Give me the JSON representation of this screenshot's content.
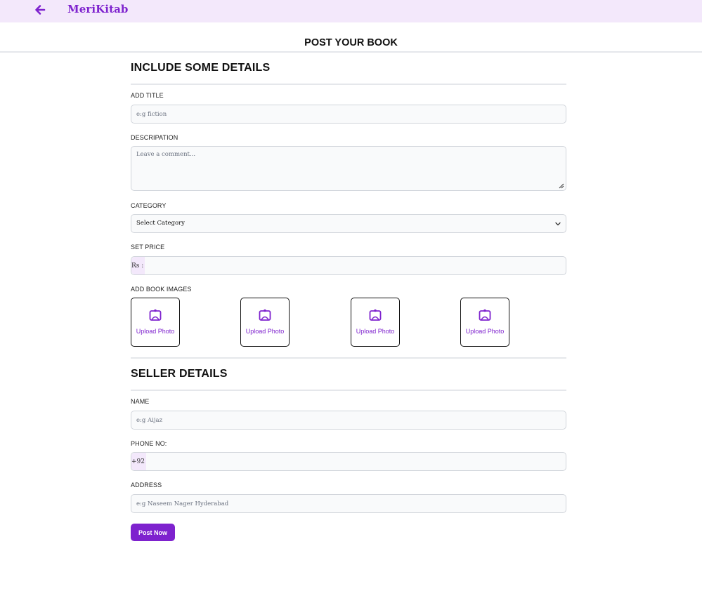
{
  "app": {
    "brand": "MeriKitab"
  },
  "page": {
    "title": "POST YOUR BOOK"
  },
  "details_section": {
    "heading": "INCLUDE SOME DETAILS",
    "title_label": "ADD TITLE",
    "title_placeholder": "e:g fiction",
    "description_label": "DESCRIPATION",
    "description_placeholder": "Leave a comment...",
    "category_label": "CATEGORY",
    "category_selected": "Select Category",
    "price_label": "SET PRICE",
    "price_prefix": "Rs :",
    "images_label": "ADD BOOK IMAGES",
    "upload_tiles": [
      {
        "label": "Upload Photo"
      },
      {
        "label": "Upload Photo"
      },
      {
        "label": "Upload Photo"
      },
      {
        "label": "Upload Photo"
      }
    ]
  },
  "seller_section": {
    "heading": "SELLER DETAILS",
    "name_label": "NAME",
    "name_placeholder": "e:g Aijaz",
    "phone_label": "PHONE NO:",
    "phone_prefix": "+92",
    "address_label": "ADDRESS",
    "address_placeholder": "e:g Naseem Nager Hyderabad"
  },
  "actions": {
    "submit_label": "Post Now"
  },
  "colors": {
    "accent": "#7e22ce",
    "topbar": "#f3e8fb"
  },
  "icons": {
    "back": "arrow-left-icon",
    "upload": "image-upload-icon",
    "select": "chevron-down-icon",
    "resize": "resize-handle-icon"
  }
}
